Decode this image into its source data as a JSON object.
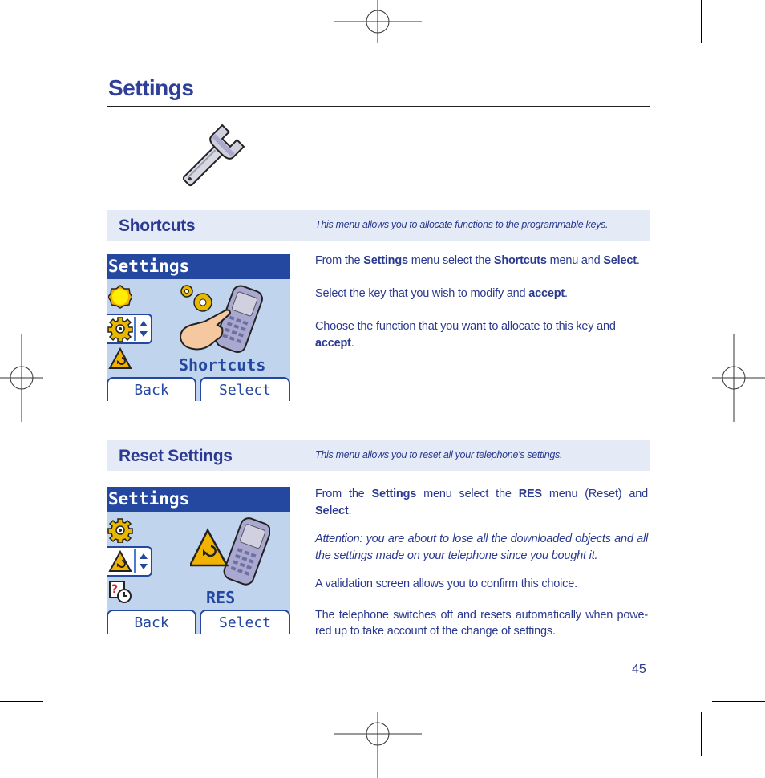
{
  "page": {
    "title": "Settings",
    "page_number": "45"
  },
  "sections": [
    {
      "title": "Shortcuts",
      "description": "This menu allows you to allocate functions to the programmable keys.",
      "screen": {
        "title": "Settings",
        "label": "Shortcuts",
        "softkey_left": "Back",
        "softkey_right": "Select",
        "menu_icons": [
          "sun-icon",
          "gear-icon",
          "warning-triangle-icon"
        ],
        "main_icon": "hand-pressing-phone-icon"
      },
      "paragraphs": [
        {
          "parts": [
            {
              "text": "From the ",
              "bold": false
            },
            {
              "text": "Settings",
              "bold": true
            },
            {
              "text": " menu select the ",
              "bold": false
            },
            {
              "text": "Shortcuts",
              "bold": true
            },
            {
              "text": " menu and ",
              "bold": false
            },
            {
              "text": "Select",
              "bold": true
            },
            {
              "text": ".",
              "bold": false
            }
          ]
        },
        {
          "parts": [
            {
              "text": "Select the key that you wish to modify and ",
              "bold": false
            },
            {
              "text": "accept",
              "bold": true
            },
            {
              "text": ".",
              "bold": false
            }
          ]
        },
        {
          "parts": [
            {
              "text": "Choose the function that you want to allocate to this key and ",
              "bold": false
            },
            {
              "text": "accept",
              "bold": true
            },
            {
              "text": ".",
              "bold": false
            }
          ]
        }
      ]
    },
    {
      "title": "Reset Settings",
      "description": "This menu allows you to reset all your telephone's settings.",
      "screen": {
        "title": "Settings",
        "label": "RES",
        "softkey_left": "Back",
        "softkey_right": "Select",
        "menu_icons": [
          "gear-icon",
          "warning-triangle-icon",
          "clock-question-icon"
        ],
        "main_icon": "warning-phone-icon"
      },
      "paragraphs": [
        {
          "parts": [
            {
              "text": "From the ",
              "bold": false
            },
            {
              "text": "Settings",
              "bold": true
            },
            {
              "text": " menu select the ",
              "bold": false
            },
            {
              "text": "RES",
              "bold": true
            },
            {
              "text": " menu (Reset) and ",
              "bold": false
            },
            {
              "text": "Select",
              "bold": true
            },
            {
              "text": ".",
              "bold": false
            }
          ]
        },
        {
          "italic": true,
          "parts": [
            {
              "text": "Attention: you are about to lose all the downloaded objects and all the settings made on your telephone since you bought it.",
              "bold": false
            }
          ]
        },
        {
          "parts": [
            {
              "text": "A validation screen allows you to confirm this choice.",
              "bold": false
            }
          ]
        },
        {
          "parts": [
            {
              "text": "The telephone switches off and resets automatically when powe-red up to take account of the change of settings.",
              "bold": false
            }
          ]
        }
      ]
    }
  ],
  "colors": {
    "text_blue": "#2b3990",
    "band_bg": "#e4ebf6",
    "screen_bg": "#c1d4ee",
    "screen_title_bg": "#2447a0"
  }
}
